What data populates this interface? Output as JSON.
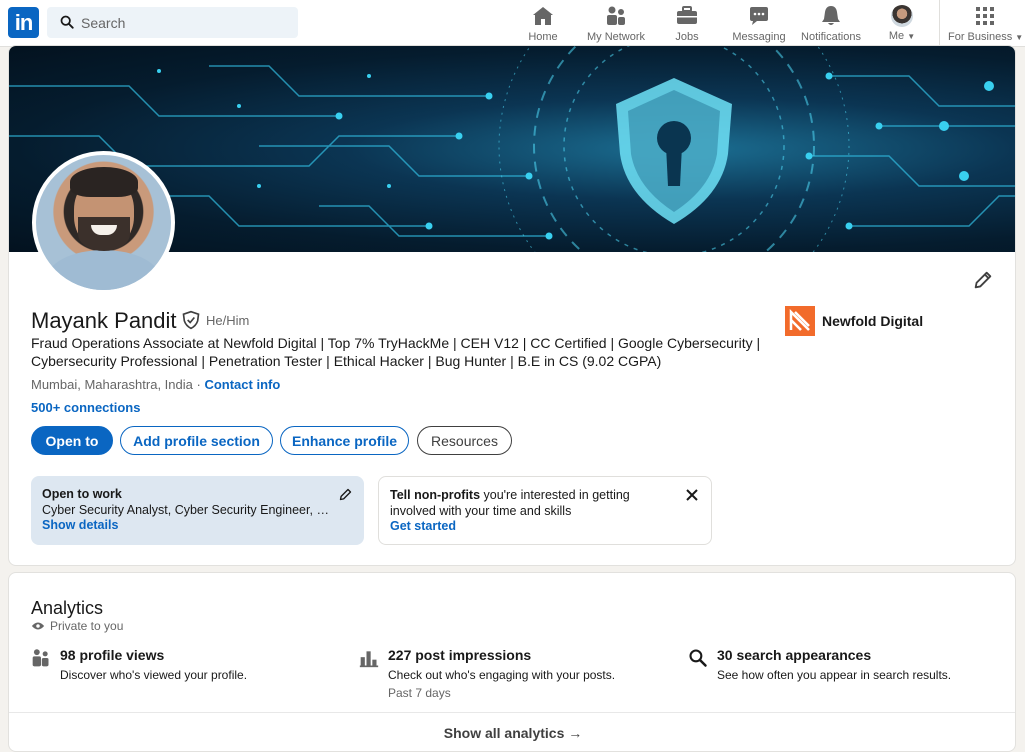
{
  "nav": {
    "search_placeholder": "Search",
    "items": [
      {
        "label": "Home",
        "icon": "home-icon"
      },
      {
        "label": "My Network",
        "icon": "network-icon"
      },
      {
        "label": "Jobs",
        "icon": "briefcase-icon"
      },
      {
        "label": "Messaging",
        "icon": "message-icon"
      },
      {
        "label": "Notifications",
        "icon": "bell-icon"
      },
      {
        "label": "Me",
        "icon": "avatar"
      },
      {
        "label": "For Business",
        "icon": "grid-icon"
      }
    ]
  },
  "profile": {
    "name": "Mayank Pandit",
    "pronouns": "He/Him",
    "headline": "Fraud Operations Associate at Newfold Digital | Top 7% TryHackMe | CEH V12 | CC Certified | Google Cybersecurity | Cybersecurity Professional | Penetration Tester | Ethical Hacker | Bug Hunter | B.E in CS (9.02 CGPA)",
    "location": "Mumbai, Maharashtra, India",
    "separator": "·",
    "contact_info": "Contact info",
    "connections": "500+ connections",
    "company": "Newfold Digital",
    "buttons": {
      "open_to": "Open to",
      "add_section": "Add profile section",
      "enhance": "Enhance profile",
      "resources": "Resources"
    },
    "open_to_work": {
      "title": "Open to work",
      "roles": "Cyber Security Analyst, Cyber Security Engineer, C...",
      "link": "Show details"
    },
    "nonprofit": {
      "bold": "Tell non-profits",
      "text": " you're interested in getting involved with your time and skills",
      "link": "Get started"
    }
  },
  "analytics": {
    "title": "Analytics",
    "privacy": "Private to you",
    "items": [
      {
        "title": "98 profile views",
        "subtitle": "Discover who's viewed your profile.",
        "period": "",
        "icon": "people-icon"
      },
      {
        "title": "227 post impressions",
        "subtitle": "Check out who's engaging with your posts.",
        "period": "Past 7 days",
        "icon": "bar-chart-icon"
      },
      {
        "title": "30 search appearances",
        "subtitle": "See how often you appear in search results.",
        "period": "",
        "icon": "search-icon"
      }
    ],
    "show_all": "Show all analytics →"
  },
  "colors": {
    "brand": "#0a66c2",
    "company_logo": "#f26b2b",
    "open_to_work_bg": "#dde7f1"
  }
}
